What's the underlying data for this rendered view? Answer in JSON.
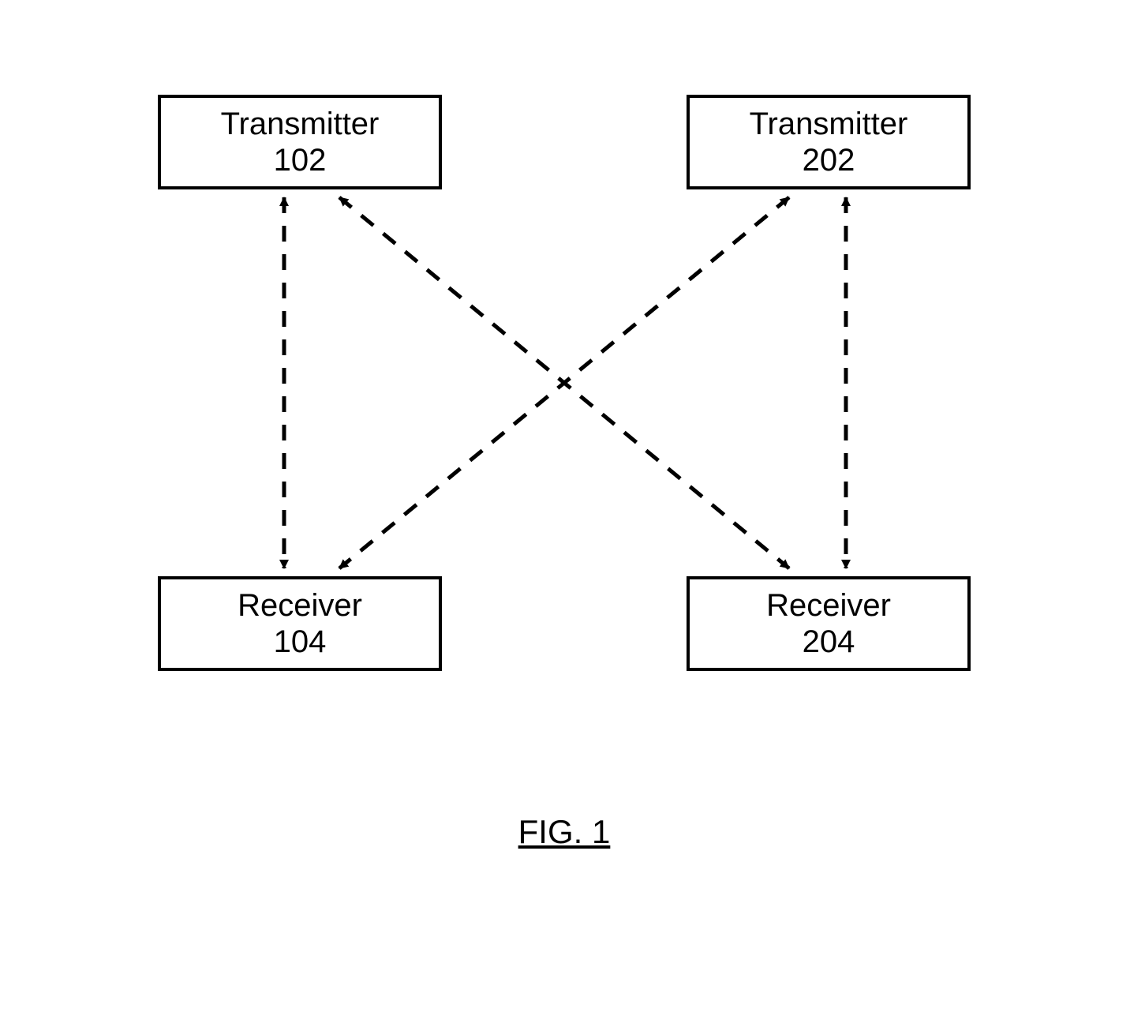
{
  "boxes": {
    "transmitter1": {
      "label": "Transmitter",
      "num": "102"
    },
    "transmitter2": {
      "label": "Transmitter",
      "num": "202"
    },
    "receiver1": {
      "label": "Receiver",
      "num": "104"
    },
    "receiver2": {
      "label": "Receiver",
      "num": "204"
    }
  },
  "connections": [
    {
      "from": "transmitter1",
      "to": "receiver1",
      "bidirectional": true,
      "style": "dashed"
    },
    {
      "from": "transmitter1",
      "to": "receiver2",
      "bidirectional": true,
      "style": "dashed"
    },
    {
      "from": "transmitter2",
      "to": "receiver1",
      "bidirectional": true,
      "style": "dashed"
    },
    {
      "from": "transmitter2",
      "to": "receiver2",
      "bidirectional": true,
      "style": "dashed"
    }
  ],
  "caption": "FIG. 1"
}
